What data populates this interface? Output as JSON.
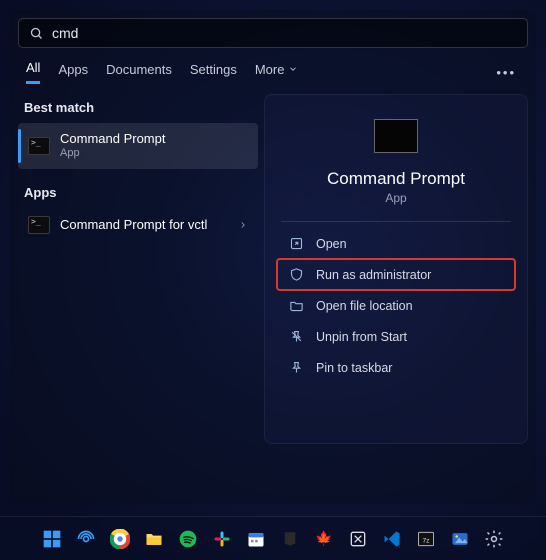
{
  "search": {
    "query": "cmd"
  },
  "tabs": {
    "all": "All",
    "apps": "Apps",
    "documents": "Documents",
    "settings": "Settings",
    "more": "More"
  },
  "left": {
    "best_match_h": "Best match",
    "best_match": {
      "title": "Command Prompt",
      "sub": "App"
    },
    "apps_h": "Apps",
    "app1": {
      "title": "Command Prompt for vctl"
    }
  },
  "preview": {
    "title": "Command Prompt",
    "sub": "App"
  },
  "actions": {
    "open": "Open",
    "run_admin": "Run as administrator",
    "open_loc": "Open file location",
    "unpin_start": "Unpin from Start",
    "pin_taskbar": "Pin to taskbar"
  }
}
